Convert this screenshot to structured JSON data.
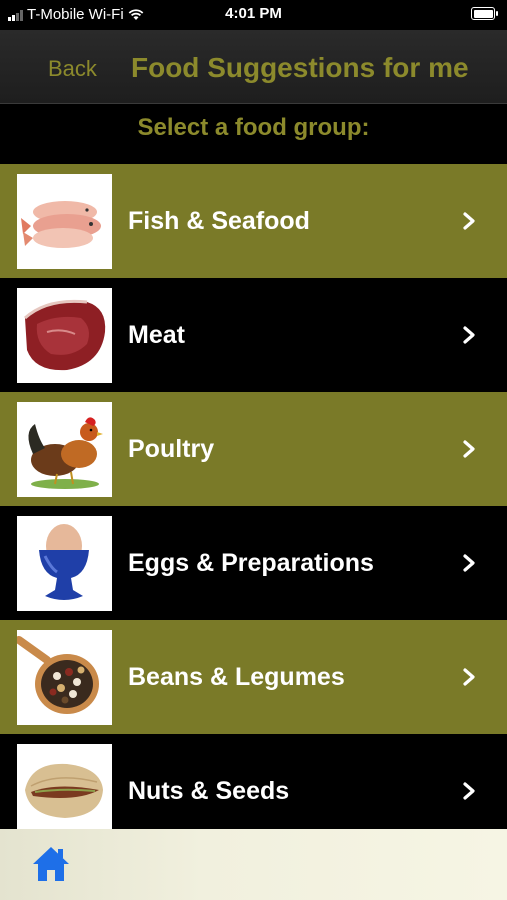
{
  "status": {
    "carrier": "T-Mobile Wi-Fi",
    "time": "4:01 PM"
  },
  "nav": {
    "back_label": "Back",
    "title": "Food Suggestions for me"
  },
  "prompt": "Select a food group:",
  "food_groups": [
    {
      "label": "Fish & Seafood",
      "icon": "fish-image"
    },
    {
      "label": "Meat",
      "icon": "steak-image"
    },
    {
      "label": "Poultry",
      "icon": "rooster-image"
    },
    {
      "label": "Eggs & Preparations",
      "icon": "egg-cup-image"
    },
    {
      "label": "Beans & Legumes",
      "icon": "beans-spoon-image"
    },
    {
      "label": "Nuts & Seeds",
      "icon": "pistachio-image"
    }
  ],
  "colors": {
    "accent_olive": "#7a7a28",
    "title_olive": "#8c8a2c",
    "home_blue": "#1e6fe8"
  },
  "tab_bar": {
    "home_icon": "home-icon"
  }
}
